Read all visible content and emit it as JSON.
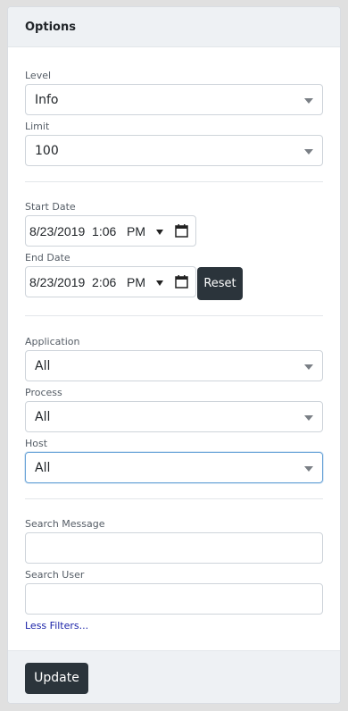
{
  "header": {
    "title": "Options"
  },
  "filters": {
    "level": {
      "label": "Level",
      "value": "Info"
    },
    "limit": {
      "label": "Limit",
      "value": "100"
    },
    "start_date": {
      "label": "Start Date",
      "value": "8/23/2019  1:06   PM"
    },
    "end_date": {
      "label": "End Date",
      "value": "8/23/2019  2:06   PM"
    },
    "reset_label": "Reset",
    "application": {
      "label": "Application",
      "value": "All"
    },
    "process": {
      "label": "Process",
      "value": "All"
    },
    "host": {
      "label": "Host",
      "value": "All"
    },
    "search_message": {
      "label": "Search Message",
      "value": ""
    },
    "search_user": {
      "label": "Search User",
      "value": ""
    },
    "less_filters_label": "Less Filters..."
  },
  "footer": {
    "update_label": "Update"
  },
  "colors": {
    "dark_button": "#2b343b",
    "link": "#1a22a8",
    "focus_border": "#6aa4d8"
  }
}
